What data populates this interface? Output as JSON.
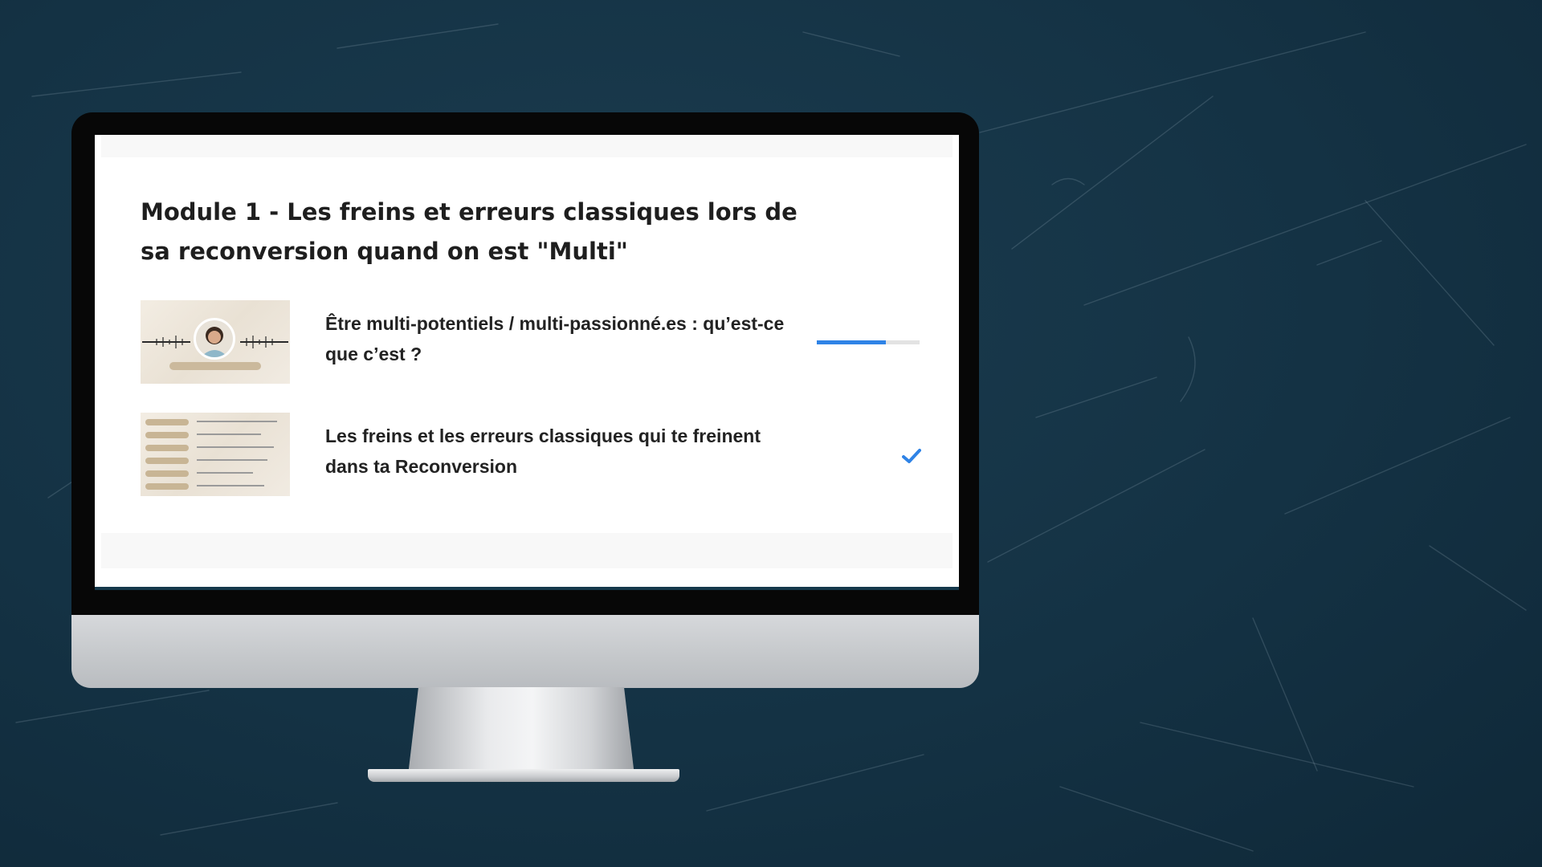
{
  "module": {
    "title": "Module 1 - Les freins et erreurs classiques lors de sa reconversion quand on est \"Multi\""
  },
  "lessons": [
    {
      "title": "Être multi-potentiels / multi-passionné.es : qu’est-ce que c’est ?",
      "status": "in-progress",
      "progress_fraction": 0.67,
      "thumbnail_icon": "podcast-portrait-thumbnail"
    },
    {
      "title": "Les freins et les erreurs classiques qui te freinent dans ta Reconversion",
      "status": "completed",
      "status_icon": "checkmark-icon",
      "thumbnail_icon": "slide-list-thumbnail"
    }
  ],
  "colors": {
    "background": "#143244",
    "accent": "#2f83e6",
    "text": "#1e1e1e"
  }
}
